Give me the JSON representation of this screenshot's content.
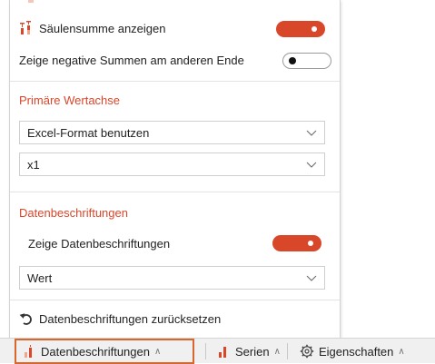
{
  "colors": {
    "accent": "#d9472b",
    "tab_highlight": "#d9672b"
  },
  "panel": {
    "column_sum": {
      "label": "Säulensumme anzeigen",
      "icon": "column-sum-icon",
      "enabled": true
    },
    "negative_sums": {
      "label": "Zeige negative Summen am anderen Ende",
      "enabled": false
    },
    "primary_axis": {
      "title": "Primäre Wertachse",
      "format_value": "Excel-Format benutzen",
      "scale_value": "x1"
    },
    "data_labels": {
      "title": "Datenbeschriftungen",
      "show_label": "Zeige Datenbeschriftungen",
      "show_enabled": true,
      "content_value": "Wert"
    },
    "reset": {
      "label": "Datenbeschriftungen zurücksetzen",
      "icon": "undo-icon"
    }
  },
  "bottom_tabs": [
    {
      "label": "Datenbeschriftungen",
      "icon": "data-labels-chart-icon",
      "active": true
    },
    {
      "label": "Serien",
      "icon": "series-chart-icon",
      "active": false
    },
    {
      "label": "Eigenschaften",
      "icon": "gear-icon",
      "active": false
    }
  ]
}
